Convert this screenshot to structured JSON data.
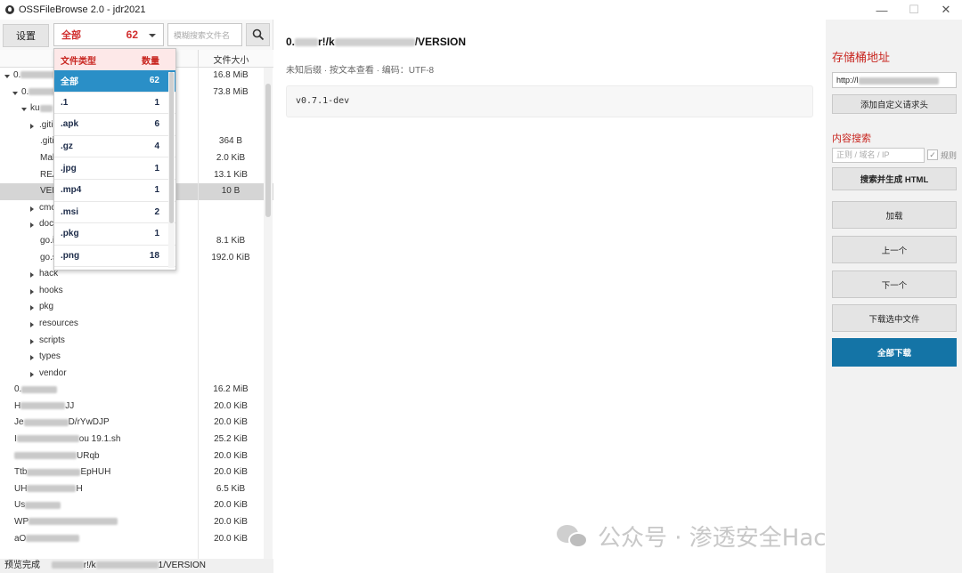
{
  "window": {
    "title": "OSSFileBrowse 2.0 - jdr2021",
    "min_glyph": "—",
    "max_glyph": "☐",
    "close_glyph": "✕"
  },
  "toolbar": {
    "settings_label": "设置",
    "type_filter_label": "全部",
    "type_filter_count": "62",
    "name_search_placeholder": "模糊搜索文件名"
  },
  "tree": {
    "size_header": "文件大小",
    "rows": [
      {
        "name": "0.",
        "size": "16.8 MiB",
        "indent": 5,
        "arrow": "down",
        "blur": 50
      },
      {
        "name": "0.",
        "size": "73.8 MiB",
        "indent": 14,
        "arrow": "down",
        "blur": 30
      },
      {
        "name": "ku",
        "size": "",
        "indent": 24,
        "arrow": "down",
        "blur": 14
      },
      {
        "name": ".giti",
        "size": "",
        "indent": 34,
        "arrow": "right",
        "blur": 0
      },
      {
        "name": ".giti",
        "size": "364 B",
        "indent": 34,
        "arrow": "",
        "blur": 0
      },
      {
        "name": "Mal",
        "size": "2.0 KiB",
        "indent": 34,
        "arrow": "",
        "blur": 0
      },
      {
        "name": "REA",
        "size": "13.1 KiB",
        "indent": 34,
        "arrow": "",
        "blur": 0
      },
      {
        "name": "VER",
        "size": "10 B",
        "indent": 34,
        "arrow": "",
        "blur": 0,
        "selected": true
      },
      {
        "name": "cmc",
        "size": "",
        "indent": 34,
        "arrow": "right",
        "blur": 0
      },
      {
        "name": "doc",
        "size": "",
        "indent": 34,
        "arrow": "right",
        "blur": 0
      },
      {
        "name": "go.i",
        "size": "8.1 KiB",
        "indent": 34,
        "arrow": "",
        "blur": 0
      },
      {
        "name": "go.s",
        "size": "192.0 KiB",
        "indent": 34,
        "arrow": "",
        "blur": 0
      },
      {
        "name": "hack",
        "size": "",
        "indent": 34,
        "arrow": "right",
        "blur": 0
      },
      {
        "name": "hooks",
        "size": "",
        "indent": 34,
        "arrow": "right",
        "blur": 0
      },
      {
        "name": "pkg",
        "size": "",
        "indent": 34,
        "arrow": "right",
        "blur": 0
      },
      {
        "name": "resources",
        "size": "",
        "indent": 34,
        "arrow": "right",
        "blur": 0
      },
      {
        "name": "scripts",
        "size": "",
        "indent": 34,
        "arrow": "right",
        "blur": 0
      },
      {
        "name": "types",
        "size": "",
        "indent": 34,
        "arrow": "right",
        "blur": 0
      },
      {
        "name": "vendor",
        "size": "",
        "indent": 34,
        "arrow": "right",
        "blur": 0
      },
      {
        "name": "0.",
        "size": "16.2 MiB",
        "indent": 5,
        "arrow": "",
        "blur": 40
      },
      {
        "name": "H",
        "size": "20.0 KiB",
        "indent": 5,
        "arrow": "",
        "blur": 50,
        "suffix": "JJ"
      },
      {
        "name": "Je",
        "size": "20.0 KiB",
        "indent": 5,
        "arrow": "",
        "blur": 50,
        "suffix": "D/rYwDJP"
      },
      {
        "name": "I",
        "size": "25.2 KiB",
        "indent": 5,
        "arrow": "",
        "blur": 70,
        "suffix": "ou 19.1.sh"
      },
      {
        "name": "",
        "size": "20.0 KiB",
        "indent": 5,
        "arrow": "",
        "blur": 70,
        "suffix": "URqb"
      },
      {
        "name": "Ttb",
        "size": "20.0 KiB",
        "indent": 5,
        "arrow": "",
        "blur": 60,
        "suffix": "EpHUH"
      },
      {
        "name": "UH",
        "size": "6.5 KiB",
        "indent": 5,
        "arrow": "",
        "blur": 55,
        "suffix": "H"
      },
      {
        "name": "Us",
        "size": "20.0 KiB",
        "indent": 5,
        "arrow": "",
        "blur": 40
      },
      {
        "name": "WP",
        "size": "20.0 KiB",
        "indent": 5,
        "arrow": "",
        "blur": 100
      },
      {
        "name": "aO",
        "size": "20.0 KiB",
        "indent": 5,
        "arrow": "",
        "blur": 60
      }
    ]
  },
  "dropdown": {
    "header_type": "文件类型",
    "header_count": "数量",
    "items": [
      {
        "type": "全部",
        "count": "62",
        "active": true
      },
      {
        "type": ".1",
        "count": "1"
      },
      {
        "type": ".apk",
        "count": "6"
      },
      {
        "type": ".gz",
        "count": "4"
      },
      {
        "type": ".jpg",
        "count": "1"
      },
      {
        "type": ".mp4",
        "count": "1"
      },
      {
        "type": ".msi",
        "count": "2"
      },
      {
        "type": ".pkg",
        "count": "1"
      },
      {
        "type": ".png",
        "count": "18"
      }
    ]
  },
  "status": {
    "prefix": "预览完成",
    "path_tail_1": "r!/k",
    "path_tail_2": "1/VERSION"
  },
  "preview": {
    "path_head": "0.",
    "path_mid": "r!/k",
    "path_tail": "/VERSION",
    "meta": "未知后缀 · 按文本查看 · 编码：UTF-8",
    "content": "v0.7.1-dev"
  },
  "sidebar": {
    "bucket_title": "存储桶地址",
    "bucket_url": "http://l",
    "add_header_label": "添加自定义请求头",
    "content_search_title": "内容搜索",
    "search_placeholder": "正则 / 域名 / IP",
    "regex_label": "规则",
    "search_html_label": "搜索并生成 HTML",
    "load_label": "加载",
    "prev_label": "上一个",
    "next_label": "下一个",
    "download_selected_label": "下载选中文件",
    "download_all_label": "全部下载"
  },
  "watermark": {
    "text": "公众号 · 渗透安全HackTwo"
  },
  "colors": {
    "accent_red": "#c8251f",
    "primary_blue": "#1474a6",
    "dropdown_active": "#2a8fc7"
  }
}
